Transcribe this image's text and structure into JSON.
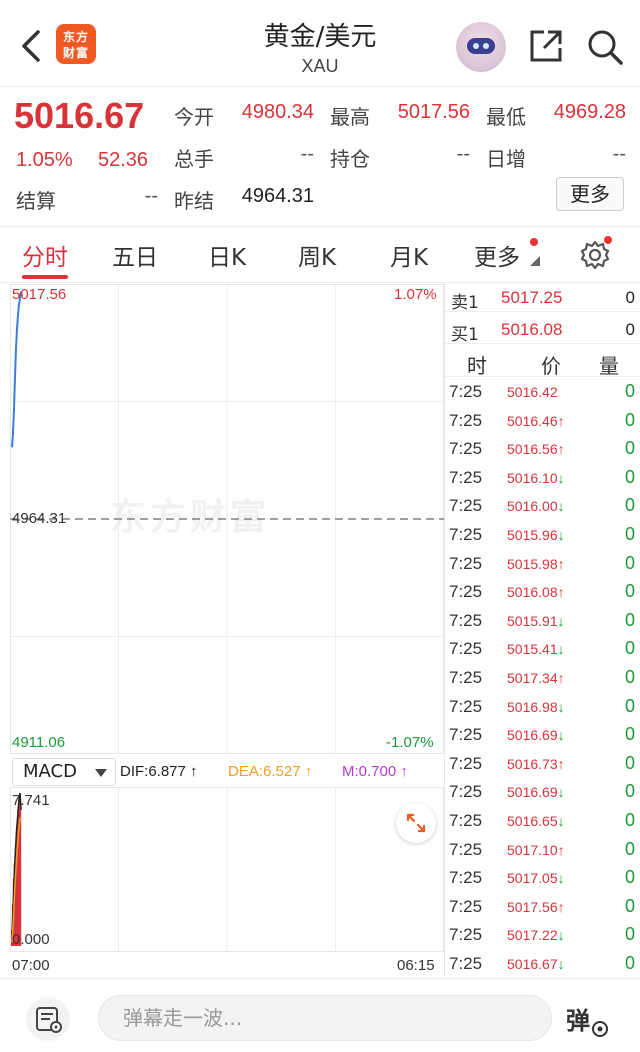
{
  "header": {
    "title": "黄金/美元",
    "subtitle": "XAU",
    "logo_text": "东方财富",
    "icons": [
      "back-arrow-icon",
      "assistant-robot-icon",
      "share-icon",
      "search-icon"
    ]
  },
  "quote": {
    "price": "5016.67",
    "change_pct": "1.05%",
    "change": "52.36",
    "open_label": "今开",
    "open": "4980.34",
    "high_label": "最高",
    "high": "5017.56",
    "low_label": "最低",
    "low": "4969.28",
    "volume_label": "总手",
    "volume": "--",
    "position_label": "持仓",
    "position": "--",
    "daily_inc_label": "日增",
    "daily_inc": "--",
    "settle_label": "结算",
    "settle": "--",
    "prev_settle_label": "昨结",
    "prev_settle": "4964.31",
    "more_label": "更多"
  },
  "tabs": [
    "分时",
    "五日",
    "日K",
    "周K",
    "月K",
    "更多"
  ],
  "active_tab": "分时",
  "chart_data": {
    "type": "line",
    "title": "",
    "xlabel": "",
    "ylabel": "",
    "x_tick_labels": [
      "07:00",
      "06:15"
    ],
    "y_max_label": "5017.56",
    "y_mid_label": "4964.31",
    "y_min_label": "4911.06",
    "pct_max_label": "1.07%",
    "pct_min_label": "-1.07%",
    "ylim": [
      4911.06,
      5017.56
    ],
    "series": [
      {
        "values": [
          4981.2,
          4984.5,
          4990.1,
          4997.6,
          5004.3,
          5008.9,
          5012.2,
          5014.6,
          5016.1,
          5017.56,
          5016.67
        ]
      }
    ],
    "macd": {
      "indicator": "MACD",
      "dif_label": "DIF:6.877 ↑",
      "dea_label": "DEA:6.527 ↑",
      "m_label": "M:0.700 ↑",
      "y_max_label": "7.741",
      "y_min_label": "0.000",
      "ylim": [
        0,
        7.741
      ],
      "bars": [
        0.8,
        2.1,
        3.4,
        4.2,
        4.9,
        5.6,
        6.2,
        6.9,
        7.4,
        7.741,
        6.877
      ],
      "dif": [
        0.5,
        1.8,
        3.0,
        4.1,
        5.0,
        5.8,
        6.4,
        7.0,
        7.5,
        7.741,
        6.877
      ],
      "dea": [
        0.2,
        0.9,
        1.9,
        2.8,
        3.6,
        4.4,
        5.0,
        5.6,
        6.1,
        6.4,
        6.527
      ]
    }
  },
  "watermark": "东方财富",
  "order_book": {
    "ask": {
      "label": "卖1",
      "price": "5017.25",
      "volume": "0"
    },
    "bid": {
      "label": "买1",
      "price": "5016.08",
      "volume": "0"
    },
    "headers": {
      "time": "时",
      "price": "价",
      "volume": "量"
    }
  },
  "trades": [
    {
      "time": "7:25",
      "price": "5016.42",
      "arrow": "",
      "volume": "0"
    },
    {
      "time": "7:25",
      "price": "5016.46",
      "arrow": "↑",
      "volume": "0"
    },
    {
      "time": "7:25",
      "price": "5016.56",
      "arrow": "↑",
      "volume": "0"
    },
    {
      "time": "7:25",
      "price": "5016.10",
      "arrow": "↓",
      "volume": "0"
    },
    {
      "time": "7:25",
      "price": "5016.00",
      "arrow": "↓",
      "volume": "0"
    },
    {
      "time": "7:25",
      "price": "5015.96",
      "arrow": "↓",
      "volume": "0"
    },
    {
      "time": "7:25",
      "price": "5015.98",
      "arrow": "↑",
      "volume": "0"
    },
    {
      "time": "7:25",
      "price": "5016.08",
      "arrow": "↑",
      "volume": "0"
    },
    {
      "time": "7:25",
      "price": "5015.91",
      "arrow": "↓",
      "volume": "0"
    },
    {
      "time": "7:25",
      "price": "5015.41",
      "arrow": "↓",
      "volume": "0"
    },
    {
      "time": "7:25",
      "price": "5017.34",
      "arrow": "↑",
      "volume": "0"
    },
    {
      "time": "7:25",
      "price": "5016.98",
      "arrow": "↓",
      "volume": "0"
    },
    {
      "time": "7:25",
      "price": "5016.69",
      "arrow": "↓",
      "volume": "0"
    },
    {
      "time": "7:25",
      "price": "5016.73",
      "arrow": "↑",
      "volume": "0"
    },
    {
      "time": "7:25",
      "price": "5016.69",
      "arrow": "↓",
      "volume": "0"
    },
    {
      "time": "7:25",
      "price": "5016.65",
      "arrow": "↓",
      "volume": "0"
    },
    {
      "time": "7:25",
      "price": "5017.10",
      "arrow": "↑",
      "volume": "0"
    },
    {
      "time": "7:25",
      "price": "5017.05",
      "arrow": "↓",
      "volume": "0"
    },
    {
      "time": "7:25",
      "price": "5017.56",
      "arrow": "↑",
      "volume": "0"
    },
    {
      "time": "7:25",
      "price": "5017.22",
      "arrow": "↓",
      "volume": "0"
    },
    {
      "time": "7:25",
      "price": "5016.67",
      "arrow": "↓",
      "volume": "0"
    }
  ],
  "bottom_bar": {
    "input_placeholder": "弹幕走一波...",
    "danmu_button": "弹"
  },
  "colors": {
    "up": "#d9333a",
    "down": "#1a9b3a",
    "line": "#3b7fd9",
    "brand": "#f05a22",
    "dea": "#f0a020",
    "m": "#b43bd0"
  }
}
